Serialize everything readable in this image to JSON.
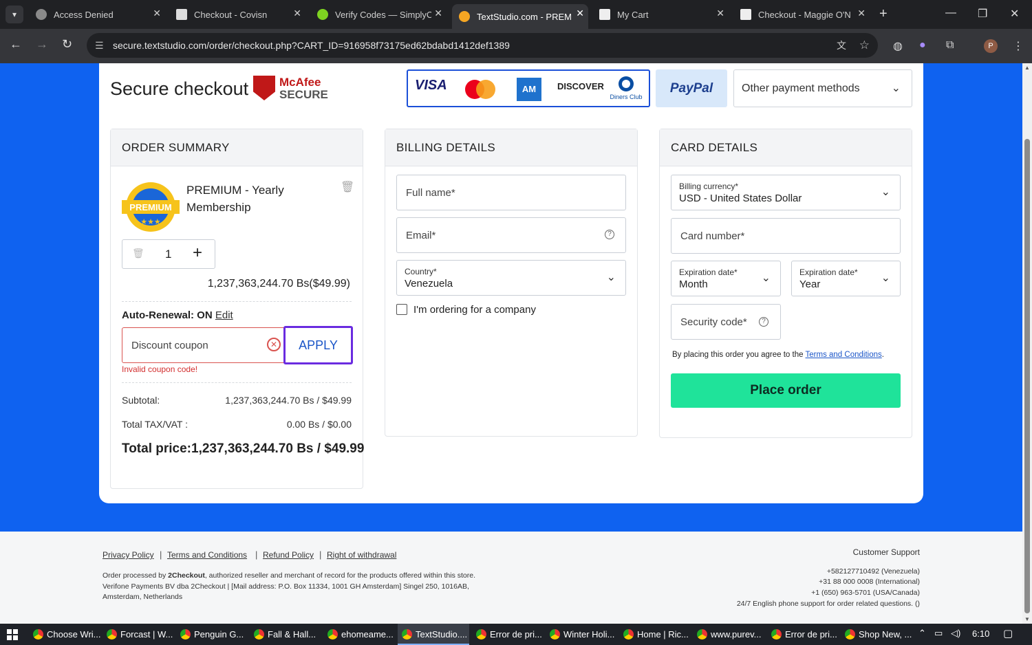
{
  "browser": {
    "tabs": [
      {
        "title": "Access Denied"
      },
      {
        "title": "Checkout - Covisn"
      },
      {
        "title": "Verify Codes — SimplyC"
      },
      {
        "title": "TextStudio.com - PREM"
      },
      {
        "title": "My Cart"
      },
      {
        "title": "Checkout - Maggie O'N"
      }
    ],
    "url": "secure.textstudio.com/order/checkout.php?CART_ID=916958f73175ed62bdabd1412def1389",
    "profile_initial": "P"
  },
  "header": {
    "title": "Secure checkout",
    "mcafee_line1": "McAfee",
    "mcafee_line2": "SECURE",
    "payment_logos": [
      "VISA",
      "DISCOVER",
      "Diners Club"
    ],
    "paypal_label": "PayPal",
    "other_methods": "Other payment methods"
  },
  "order_summary": {
    "heading": "ORDER SUMMARY",
    "badge_text": "PREMIUM",
    "product_name_line1": "PREMIUM - Yearly",
    "product_name_line2": "Membership",
    "quantity": "1",
    "item_price": "1,237,363,244.70 Bs($49.99)",
    "auto_renewal_label": "Auto-Renewal: ON",
    "edit_link": "Edit",
    "coupon_placeholder": "Discount coupon",
    "apply_label": "APPLY",
    "coupon_error": "Invalid coupon code!",
    "subtotal_label": "Subtotal:",
    "subtotal_value": "1,237,363,244.70 Bs / $49.99",
    "tax_label": "Total TAX/VAT :",
    "tax_value": "0.00 Bs / $0.00",
    "total_label": "Total price:",
    "total_value": "1,237,363,244.70 Bs / $49.99"
  },
  "billing": {
    "heading": "BILLING DETAILS",
    "full_name_placeholder": "Full name*",
    "email_placeholder": "Email*",
    "country_label": "Country*",
    "country_value": "Venezuela",
    "company_checkbox_label": "I'm ordering for a company"
  },
  "card": {
    "heading": "CARD DETAILS",
    "currency_label": "Billing currency*",
    "currency_value": "USD - United States Dollar",
    "card_number_placeholder": "Card number*",
    "exp_month_label": "Expiration date*",
    "exp_month_value": "Month",
    "exp_year_label": "Expiration date*",
    "exp_year_value": "Year",
    "security_placeholder": "Security code*",
    "terms_prefix": "By placing this order you agree to the",
    "terms_link": "Terms and Conditions",
    "terms_suffix": ".",
    "place_order": "Place order",
    "place_order_color": "#1fe39a"
  },
  "footer": {
    "links": [
      "Privacy Policy",
      "Terms and Conditions",
      "Refund Policy",
      "Right of withdrawal"
    ],
    "legal_prefix": "Order processed by",
    "legal_company": "2Checkout",
    "legal_rest": ", authorized reseller and merchant of record for the products offered within this store. Verifone Payments BV dba 2Checkout | [Mail address: P.O. Box 11334, 1001 GH Amsterdam] Singel 250, 1016AB, Amsterdam, Netherlands",
    "support_title": "Customer Support",
    "phones": [
      "+582127710492 (Venezuela)",
      "+31 88 000 0008 (International)",
      "+1 (650) 963-5701 (USA/Canada)",
      "24/7 English phone support for order related questions. ()"
    ]
  },
  "taskbar": {
    "items": [
      "Choose Wri...",
      "Forcast | W...",
      "Penguin G...",
      "Fall & Hall...",
      "ehomeame...",
      "TextStudio....",
      "Error de pri...",
      "Winter Holi...",
      "Home | Ric...",
      "www.purev...",
      "Error de pri...",
      "Shop New, ..."
    ],
    "time": "6:10"
  },
  "colors": {
    "page_bg": "#0f62f0",
    "apply_border": "#6a2be0",
    "error": "#d32f2f",
    "place_order": "#1fe39a"
  }
}
